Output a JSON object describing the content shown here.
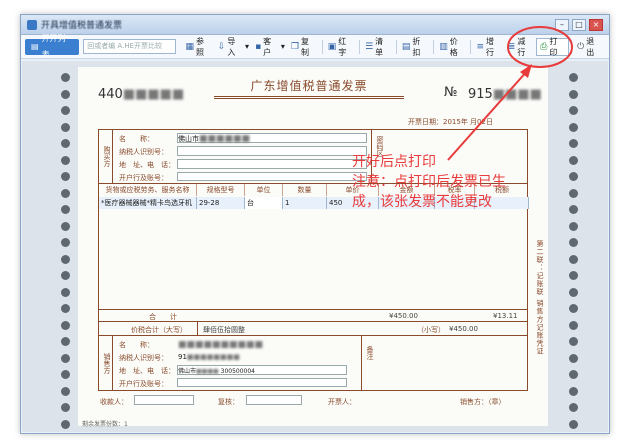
{
  "window": {
    "title": "开具增值税普通发票"
  },
  "toolbar": {
    "invoice_tab": "开开列表",
    "search_placeholder": "回或者编 A.HE开票比较",
    "buttons": [
      {
        "label": "参照",
        "icon": "reference-icon"
      },
      {
        "label": "导入",
        "icon": "import-icon"
      },
      {
        "label": "客户",
        "icon": "customer-icon"
      },
      {
        "label": "复制",
        "icon": "copy-icon"
      },
      {
        "label": "红字",
        "icon": "red-invoice-icon"
      },
      {
        "label": "清单",
        "icon": "list-icon"
      },
      {
        "label": "折扣",
        "icon": "discount-icon"
      },
      {
        "label": "价格",
        "icon": "price-icon"
      },
      {
        "label": "增行",
        "icon": "add-row-icon"
      },
      {
        "label": "减行",
        "icon": "remove-row-icon"
      },
      {
        "label": "打印",
        "icon": "print-icon"
      },
      {
        "label": "退出",
        "icon": "exit-icon"
      }
    ]
  },
  "invoice": {
    "code": "440",
    "title": "广东增值税普通发票",
    "no_label": "№",
    "no": "915",
    "date_label": "开票日期：",
    "date": "2015年 月02日",
    "buyer": {
      "side_label": "购买方",
      "name_label": "名　　称：",
      "name_value": "佛山市",
      "tax_label": "纳税人识别号：",
      "addr_label": "地　址、电　话：",
      "bank_label": "开户行及账号："
    },
    "password_label": "密码区",
    "columns": [
      "货物或应税劳务、服务名称",
      "规格型号",
      "单位",
      "数量",
      "单价",
      "金额",
      "税率",
      "税额"
    ],
    "item": {
      "name": "*医疗器械器械*精卡鸟选牙机",
      "spec": "29-28",
      "unit": "台",
      "qty": "1",
      "price": "450"
    },
    "total_label": "合　　计",
    "total_amount": "¥450.00",
    "total_tax": "¥13.11",
    "grand_label": "价税合计（大写）",
    "grand_words": "肆佰伍拾圆整",
    "grand_small_label": "（小写）",
    "grand_small": "¥450.00",
    "seller": {
      "side_label": "销售方",
      "name_label": "名　　称：",
      "tax_label": "纳税人识别号：",
      "tax_value": "91",
      "addr_label": "地　址、电　话：",
      "addr_value": "佛山市",
      "phone": "300500004",
      "bank_label": "开户行及账号：",
      "remark_label": "备注"
    },
    "payee_label": "收款人：",
    "reviewer_label": "复核：",
    "issuer_label": "开票人：",
    "seal_label": "销售方：（章）",
    "side_column": "第二联：记账联 销售方记账凭证",
    "status": "剩余发票份数：1"
  },
  "annotation": {
    "line1": "开好后点打印",
    "line2": "注意：点打印后发票已生",
    "line3": "成，该张发票不能更改",
    "color": "#e83b3b"
  }
}
